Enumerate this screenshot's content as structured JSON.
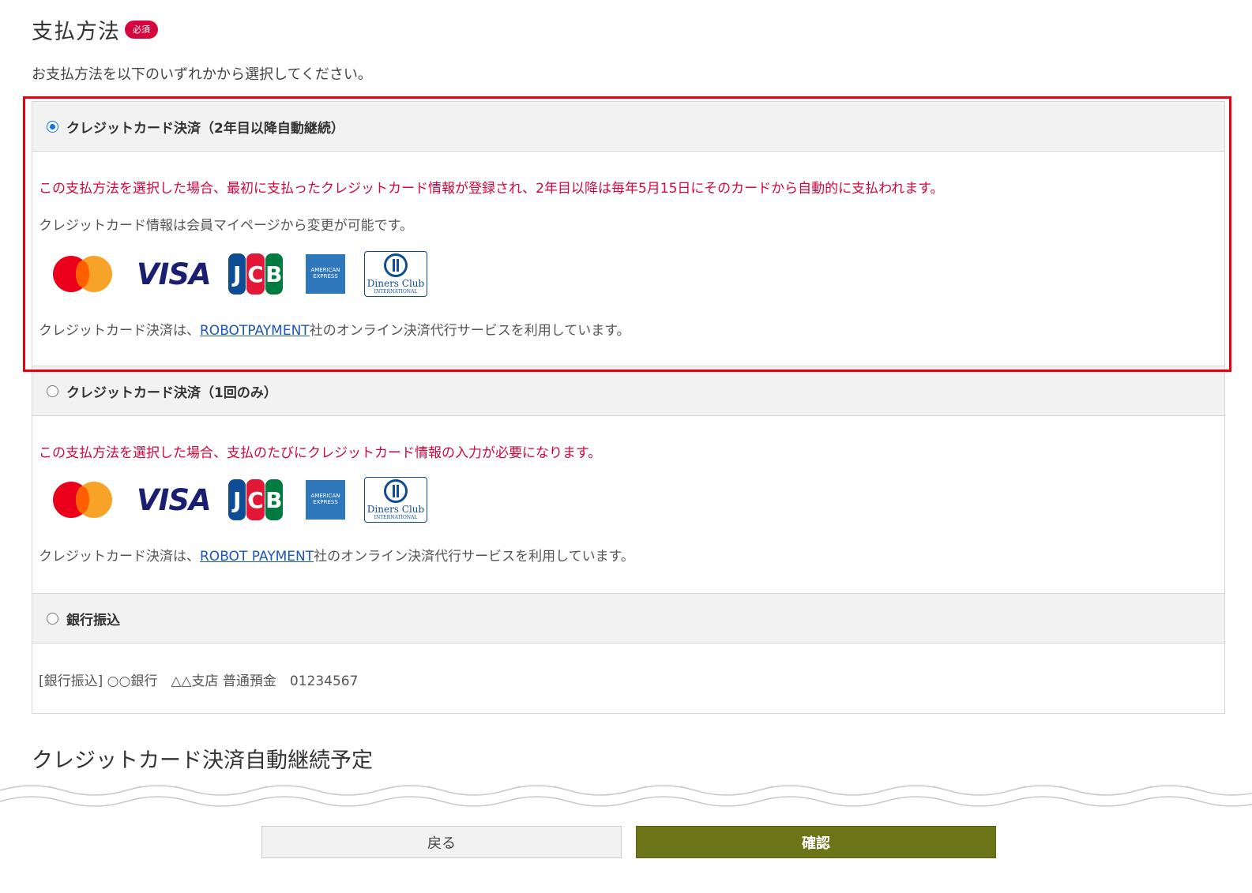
{
  "section": {
    "title": "支払方法",
    "required_badge": "必須",
    "intro": "お支払方法を以下のいずれかから選択してください。"
  },
  "options": [
    {
      "label": "クレジットカード決済（2年目以降自動継続）",
      "selected": true,
      "note_red": "この支払方法を選択した場合、最初に支払ったクレジットカード情報が登録され、2年目以降は毎年5月15日にそのカードから自動的に支払われます。",
      "note": "クレジットカード情報は会員マイページから変更が可能です。",
      "service_prefix": "クレジットカード決済は、",
      "service_link": "ROBOTPAYMENT",
      "service_suffix": "社のオンライン決済代行サービスを利用しています。"
    },
    {
      "label": "クレジットカード決済（1回のみ）",
      "selected": false,
      "note_red": "この支払方法を選択した場合、支払のたびにクレジットカード情報の入力が必要になります。",
      "service_prefix": "クレジットカード決済は、",
      "service_link": "ROBOT PAYMENT",
      "service_suffix": "社のオンライン決済代行サービスを利用しています。"
    },
    {
      "label": "銀行振込",
      "selected": false,
      "bank_info": "[銀行振込] ○○銀行　△△支店 普通預金　01234567"
    }
  ],
  "card_brands": {
    "visa": "VISA",
    "jcb": [
      "J",
      "C",
      "B"
    ],
    "amex": [
      "AMERICAN",
      "EXPRESS"
    ],
    "diners": [
      "Diners Club",
      "INTERNATIONAL"
    ]
  },
  "next_section_title": "クレジットカード決済自動継続予定",
  "buttons": {
    "back": "戻る",
    "confirm": "確認"
  },
  "colors": {
    "accent_red": "#d4063d",
    "highlight_frame": "#e60012",
    "confirm_button": "#6b7517",
    "radio_selected": "#0a75e8"
  }
}
